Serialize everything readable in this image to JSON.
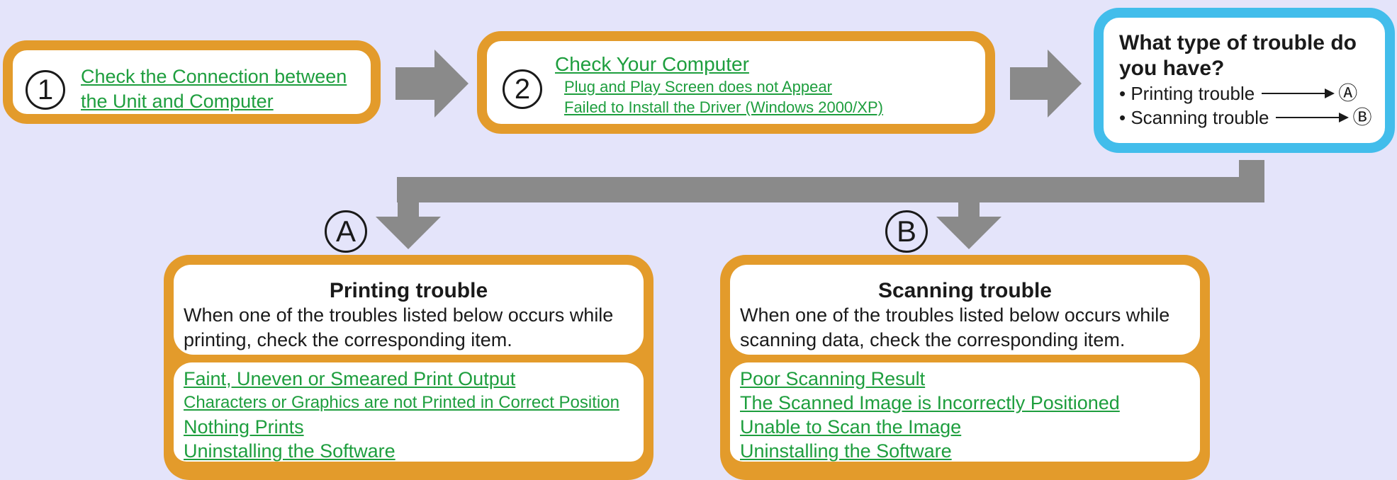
{
  "step1": {
    "number": "1",
    "links": [
      "Check the Connection between",
      "the Unit and Computer"
    ]
  },
  "step2": {
    "number": "2",
    "title_link": "Check Your Computer",
    "sub_links": [
      "Plug and Play Screen does not Appear",
      "Failed to Install the Driver (Windows 2000/XP)"
    ]
  },
  "question": {
    "title": "What type of trouble do you have?",
    "options": [
      {
        "label": "• Printing trouble",
        "target": "Ⓐ"
      },
      {
        "label": "• Scanning trouble",
        "target": "Ⓑ"
      }
    ]
  },
  "branch_a": {
    "marker": "A",
    "title": "Printing trouble",
    "description": "When one of the troubles listed below occurs while printing, check the corresponding item.",
    "links": [
      "Faint, Uneven or Smeared Print Output",
      "Characters or Graphics are not Printed in Correct Position",
      "Nothing Prints",
      "Uninstalling the Software"
    ]
  },
  "branch_b": {
    "marker": "B",
    "title": "Scanning trouble",
    "description": "When one of the troubles listed below occurs while scanning data, check the corresponding item.",
    "links": [
      "Poor Scanning Result",
      "The Scanned Image is Incorrectly Positioned",
      "Unable to Scan the Image",
      "Uninstalling the Software"
    ]
  },
  "colors": {
    "background": "#e4e4fa",
    "box_border": "#e39b2b",
    "question_border": "#42bdeb",
    "arrow": "#8a8a8a",
    "link": "#1e9e3e"
  }
}
